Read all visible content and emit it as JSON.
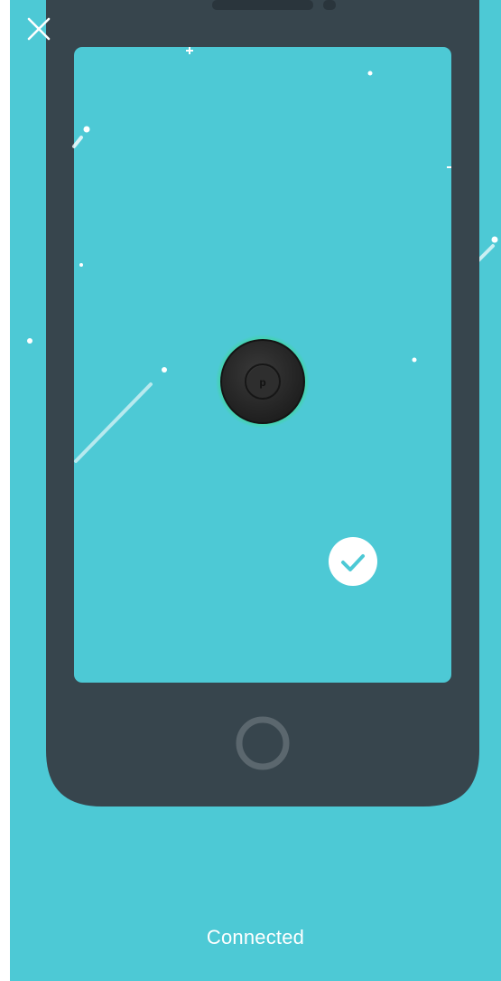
{
  "colors": {
    "background": "#4dc9d5",
    "phone_body": "#37454d",
    "screen": "#4dc9d5",
    "device_glow": "#38e07b",
    "device_body": "#2b2b2b",
    "check_circle": "#ffffff",
    "check_mark": "#4dc9d5"
  },
  "icons": {
    "close": "close-icon",
    "device": "smart-plug-device-icon",
    "success": "checkmark-icon",
    "home_button": "home-button-ring"
  },
  "status": {
    "label": "Connected"
  }
}
